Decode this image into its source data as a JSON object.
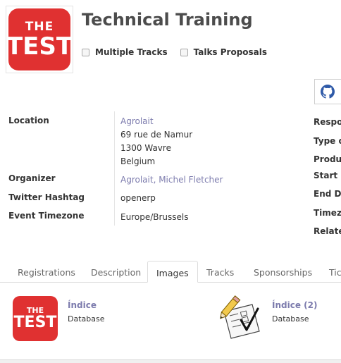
{
  "header": {
    "title": "Technical Training",
    "logo_line1": "THE",
    "logo_line2": "TEST",
    "checkboxes": [
      {
        "label": "Multiple Tracks",
        "checked": false
      },
      {
        "label": "Talks Proposals",
        "checked": false
      }
    ]
  },
  "github_button": {
    "icon": "github-icon",
    "label": "("
  },
  "info": {
    "location_label": "Location",
    "location_name": "Agrolait",
    "location_street": "69 rue de Namur",
    "location_city": "1300 Wavre",
    "location_country": "Belgium",
    "organizer_label": "Organizer",
    "organizer_value": "Agrolait, Michel Fletcher",
    "twitter_label": "Twitter Hashtag",
    "twitter_value": "openerp",
    "timezone_label": "Event Timezone",
    "timezone_value": "Europe/Brussels"
  },
  "right_labels": [
    "Respo",
    "Type o",
    "Produ",
    "Start D",
    "End Da",
    "Timez",
    "Relate"
  ],
  "tabs": [
    {
      "label": "Registrations",
      "active": false
    },
    {
      "label": "Description",
      "active": false
    },
    {
      "label": "Images",
      "active": true
    },
    {
      "label": "Tracks",
      "active": false
    },
    {
      "label": "Sponsorships",
      "active": false
    },
    {
      "label": "Tic",
      "active": false
    }
  ],
  "attachments": [
    {
      "title": "Índice",
      "subtitle": "Database",
      "thumb": "the-test-logo",
      "logo_line1": "THE",
      "logo_line2": "TEST"
    },
    {
      "title": "Índice (2)",
      "subtitle": "Database",
      "thumb": "pencil-checklist-icon"
    }
  ],
  "colors": {
    "brand_red": "#e03131",
    "link": "#7c7bad",
    "accent_orange": "#f0a33a"
  }
}
